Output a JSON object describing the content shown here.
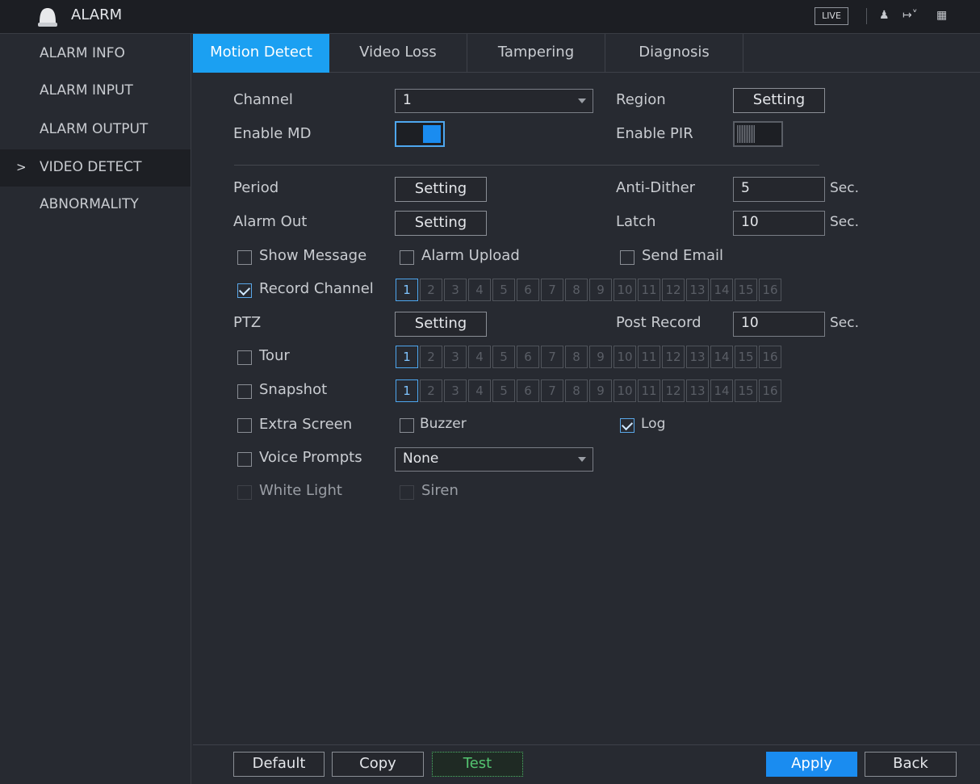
{
  "header": {
    "title": "ALARM",
    "live_label": "LIVE"
  },
  "sidebar": {
    "items": [
      {
        "label": "ALARM INFO"
      },
      {
        "label": "ALARM INPUT"
      },
      {
        "label": "ALARM OUTPUT"
      },
      {
        "label": "VIDEO DETECT",
        "active": true
      },
      {
        "label": "ABNORMALITY"
      }
    ],
    "active_marker": ">"
  },
  "tabs": [
    {
      "label": "Motion Detect",
      "active": true
    },
    {
      "label": "Video Loss"
    },
    {
      "label": "Tampering"
    },
    {
      "label": "Diagnosis"
    }
  ],
  "form": {
    "channel_label": "Channel",
    "channel_value": "1",
    "region_label": "Region",
    "region_button": "Setting",
    "enable_md_label": "Enable MD",
    "enable_md": true,
    "enable_pir_label": "Enable PIR",
    "enable_pir": false,
    "period_label": "Period",
    "period_button": "Setting",
    "anti_dither_label": "Anti-Dither",
    "anti_dither_value": "5",
    "anti_dither_unit": "Sec.",
    "alarm_out_label": "Alarm Out",
    "alarm_out_button": "Setting",
    "latch_label": "Latch",
    "latch_value": "10",
    "latch_unit": "Sec.",
    "show_message_label": "Show Message",
    "alarm_upload_label": "Alarm Upload",
    "send_email_label": "Send Email",
    "record_channel_label": "Record Channel",
    "ptz_label": "PTZ",
    "ptz_button": "Setting",
    "post_record_label": "Post Record",
    "post_record_value": "10",
    "post_record_unit": "Sec.",
    "tour_label": "Tour",
    "snapshot_label": "Snapshot",
    "extra_screen_label": "Extra Screen",
    "buzzer_label": "Buzzer",
    "log_label": "Log",
    "voice_prompts_label": "Voice Prompts",
    "voice_prompts_value": "None",
    "white_light_label": "White Light",
    "siren_label": "Siren",
    "channels": [
      "1",
      "2",
      "3",
      "4",
      "5",
      "6",
      "7",
      "8",
      "9",
      "10",
      "11",
      "12",
      "13",
      "14",
      "15",
      "16"
    ]
  },
  "footer": {
    "default_label": "Default",
    "copy_label": "Copy",
    "test_label": "Test",
    "apply_label": "Apply",
    "back_label": "Back"
  },
  "colors": {
    "accent": "#1a8cf0",
    "background": "#272a31",
    "test": "#54c571"
  }
}
